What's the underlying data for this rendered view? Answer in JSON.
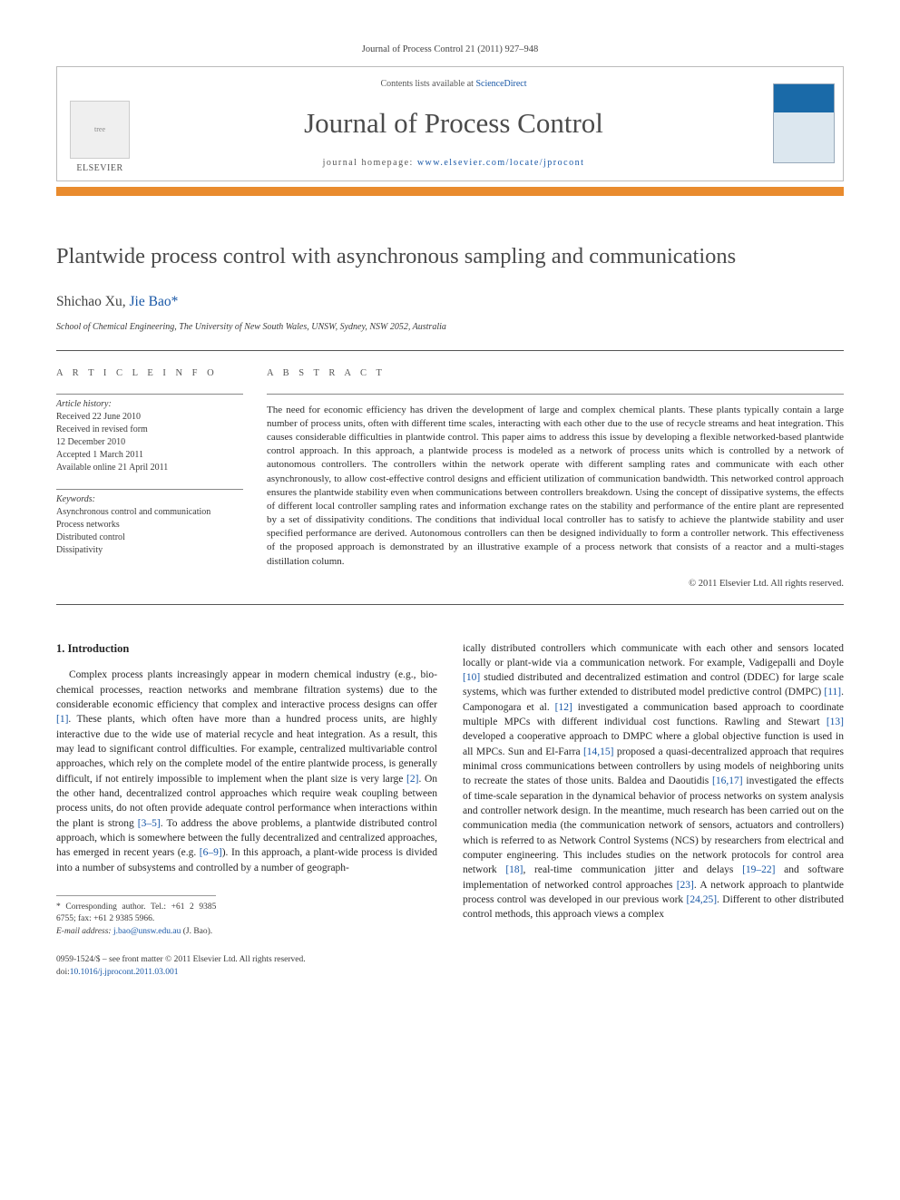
{
  "journal_ref": "Journal of Process Control 21 (2011) 927–948",
  "header": {
    "contents_prefix": "Contents lists available at ",
    "contents_link": "ScienceDirect",
    "journal_title": "Journal of Process Control",
    "homepage_prefix": "journal homepage: ",
    "homepage_url": "www.elsevier.com/locate/jprocont",
    "publisher": "ELSEVIER"
  },
  "article": {
    "title": "Plantwide process control with asynchronous sampling and communications",
    "authors_html": "Shichao Xu, Jie Bao",
    "author1": "Shichao Xu, ",
    "author2": "Jie Bao",
    "corr_mark": "*",
    "affiliation": "School of Chemical Engineering, The University of New South Wales, UNSW, Sydney, NSW 2052, Australia"
  },
  "info": {
    "heading": "a r t i c l e   i n f o",
    "history_label": "Article history:",
    "history": {
      "received": "Received 22 June 2010",
      "revised1": "Received in revised form",
      "revised2": "12 December 2010",
      "accepted": "Accepted 1 March 2011",
      "online": "Available online 21 April 2011"
    },
    "keywords_label": "Keywords:",
    "keywords": [
      "Asynchronous control and communication",
      "Process networks",
      "Distributed control",
      "Dissipativity"
    ]
  },
  "abstract": {
    "heading": "a b s t r a c t",
    "text": "The need for economic efficiency has driven the development of large and complex chemical plants. These plants typically contain a large number of process units, often with different time scales, interacting with each other due to the use of recycle streams and heat integration. This causes considerable difficulties in plantwide control. This paper aims to address this issue by developing a flexible networked-based plantwide control approach. In this approach, a plantwide process is modeled as a network of process units which is controlled by a network of autonomous controllers. The controllers within the network operate with different sampling rates and communicate with each other asynchronously, to allow cost-effective control designs and efficient utilization of communication bandwidth. This networked control approach ensures the plantwide stability even when communications between controllers breakdown. Using the concept of dissipative systems, the effects of different local controller sampling rates and information exchange rates on the stability and performance of the entire plant are represented by a set of dissipativity conditions. The conditions that individual local controller has to satisfy to achieve the plantwide stability and user specified performance are derived. Autonomous controllers can then be designed individually to form a controller network. This effectiveness of the proposed approach is demonstrated by an illustrative example of a process network that consists of a reactor and a multi-stages distillation column.",
    "copyright": "© 2011 Elsevier Ltd. All rights reserved."
  },
  "body": {
    "section_num": "1.",
    "section_title": "Introduction",
    "col1": "Complex process plants increasingly appear in modern chemical industry (e.g., bio-chemical processes, reaction networks and membrane filtration systems) due to the considerable economic efficiency that complex and interactive process designs can offer [1]. These plants, which often have more than a hundred process units, are highly interactive due to the wide use of material recycle and heat integration. As a result, this may lead to significant control difficulties. For example, centralized multivariable control approaches, which rely on the complete model of the entire plantwide process, is generally difficult, if not entirely impossible to implement when the plant size is very large [2]. On the other hand, decentralized control approaches which require weak coupling between process units, do not often provide adequate control performance when interactions within the plant is strong [3–5]. To address the above problems, a plantwide distributed control approach, which is somewhere between the fully decentralized and centralized approaches, has emerged in recent years (e.g. [6–9]). In this approach, a plant-wide process is divided into a number of subsystems and controlled by a number of geograph-",
    "col2": "ically distributed controllers which communicate with each other and sensors located locally or plant-wide via a communication network. For example, Vadigepalli and Doyle [10] studied distributed and decentralized estimation and control (DDEC) for large scale systems, which was further extended to distributed model predictive control (DMPC) [11]. Camponogara et al. [12] investigated a communication based approach to coordinate multiple MPCs with different individual cost functions. Rawling and Stewart [13] developed a cooperative approach to DMPC where a global objective function is used in all MPCs. Sun and El-Farra [14,15] proposed a quasi-decentralized approach that requires minimal cross communications between controllers by using models of neighboring units to recreate the states of those units. Baldea and Daoutidis [16,17] investigated the effects of time-scale separation in the dynamical behavior of process networks on system analysis and controller network design. In the meantime, much research has been carried out on the communication media (the communication network of sensors, actuators and controllers) which is referred to as Network Control Systems (NCS) by researchers from electrical and computer engineering. This includes studies on the network protocols for control area network [18], real-time communication jitter and delays [19–22] and software implementation of networked control approaches [23]. A network approach to plantwide process control was developed in our previous work [24,25]. Different to other distributed control methods, this approach views a complex"
  },
  "footnotes": {
    "corr": "Corresponding author. Tel.: +61 2 9385 6755; fax: +61 2 9385 5966.",
    "email_label": "E-mail address:",
    "email": "j.bao@unsw.edu.au",
    "email_who": "(J. Bao)."
  },
  "bottom": {
    "issn": "0959-1524/$ – see front matter © 2011 Elsevier Ltd. All rights reserved.",
    "doi_label": "doi:",
    "doi": "10.1016/j.jprocont.2011.03.001"
  }
}
